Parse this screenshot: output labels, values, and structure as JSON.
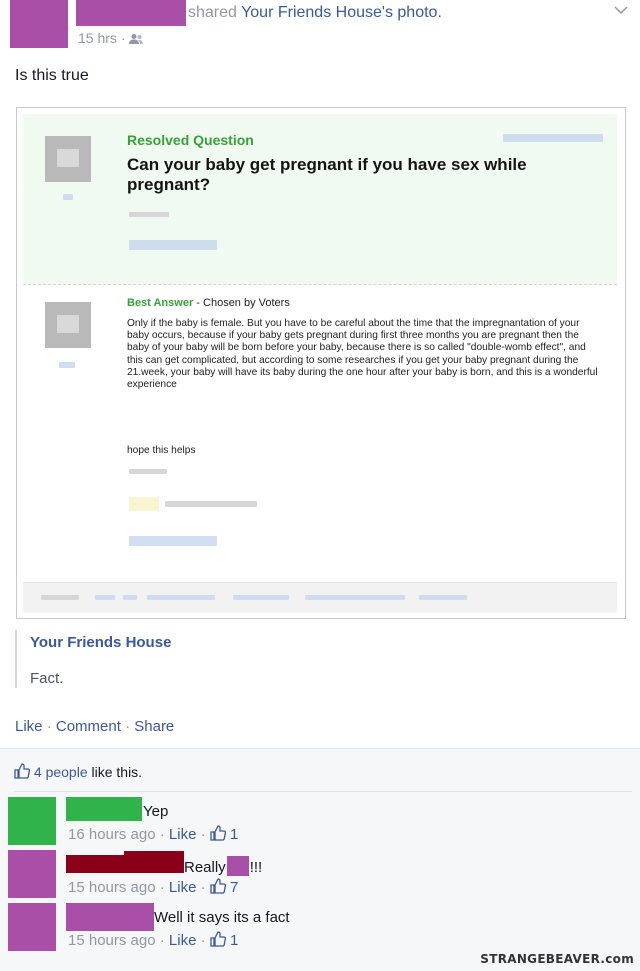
{
  "post": {
    "shared_text": "shared",
    "page_name": "Your Friends House",
    "photo_suffix": "'s photo.",
    "time": "15 hrs",
    "separator": "·",
    "body": "Is this true"
  },
  "screenshot": {
    "resolved_label": "Resolved Question",
    "question": "Can your baby get pregnant if you have sex while pregnant?",
    "best_answer_label": "Best Answer",
    "chosen_by": " - Chosen by Voters",
    "answer": "Only if the baby is female. But you have to be careful about the time that the impregnantation of your baby occurs, because if your baby gets pregnant during first three months you are pregnant then the baby of your baby will be born before your baby, because there is so called \"double-womb effect\", and this can get complicated, but according to some researches if you get your baby pregnant during the 21.week, your baby will have its baby during the one hour after your baby is born, and this is a wonderful experience",
    "sign_off": "hope this helps"
  },
  "shared_source": {
    "name": "Your Friends House",
    "caption": "Fact."
  },
  "actions": {
    "like": "Like",
    "comment": "Comment",
    "share": "Share",
    "sep": " · "
  },
  "likes": {
    "count_text": "4 people",
    "suffix": " like this."
  },
  "comments": [
    {
      "text": "Yep",
      "time": "16 hours ago",
      "like": "Like",
      "likes": "1",
      "avatar_color": "#2fb34a"
    },
    {
      "text_a": "Really",
      "text_b": "!!!",
      "time": "15 hours ago",
      "like": "Like",
      "likes": "7",
      "avatar_color": "#a94fa8"
    },
    {
      "text": "Well it says its a fact",
      "time": "15 hours ago",
      "like": "Like",
      "likes": "1",
      "avatar_color": "#a94fa8"
    }
  ],
  "watermark": "STRANGEBEAVER.com",
  "colors": {
    "link": "#3b5998",
    "redact_purple": "#a94fa8",
    "redact_green": "#2fb34a",
    "redact_maroon": "#8b0018",
    "yahoo_green": "#3aa13a"
  },
  "icons": [
    "friends-icon",
    "thumbs-up-icon",
    "chevron-down-icon"
  ]
}
